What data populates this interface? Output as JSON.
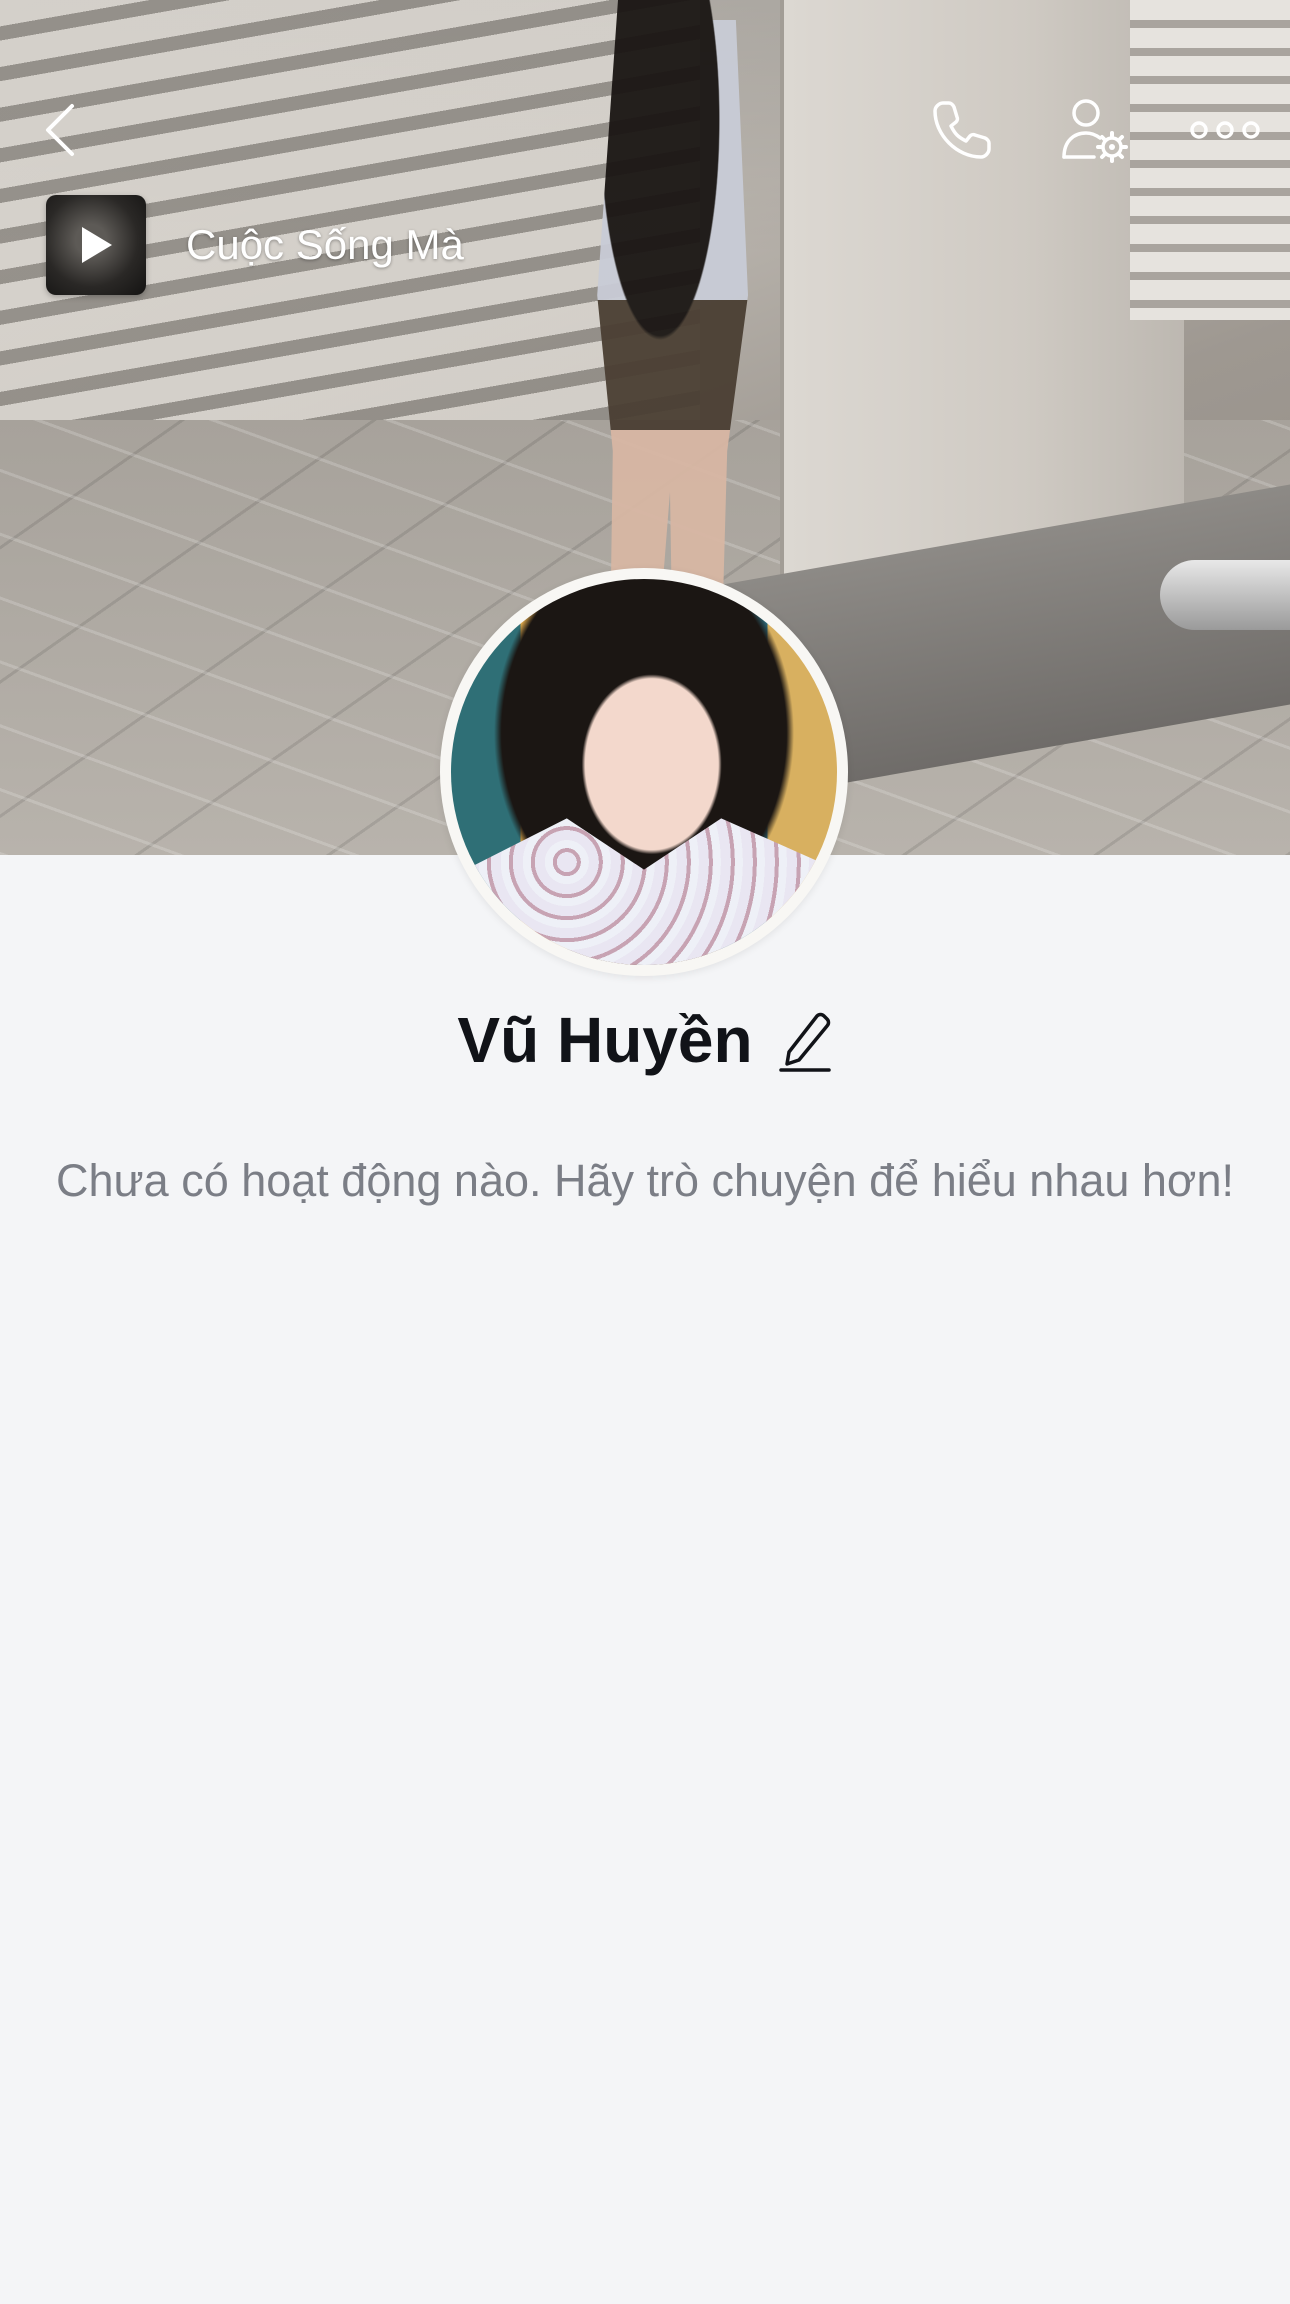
{
  "header": {
    "back_icon": "chevron-left-icon",
    "actions": [
      {
        "name": "call-icon"
      },
      {
        "name": "user-settings-icon"
      },
      {
        "name": "more-icon"
      }
    ]
  },
  "music": {
    "title": "Cuộc Sống Mà",
    "play_icon": "play-icon"
  },
  "profile": {
    "name": "Vũ Huyền",
    "edit_icon": "pencil-icon"
  },
  "activity": {
    "empty_message": "Chưa có hoạt động nào. Hãy trò chuyện để hiểu nhau hơn!"
  },
  "colors": {
    "background": "#f4f5f7",
    "name_text": "#111318",
    "secondary_text": "#7b7e86",
    "icon_white": "#ffffff"
  }
}
